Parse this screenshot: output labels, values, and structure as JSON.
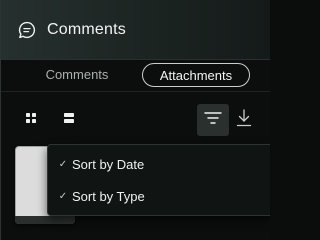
{
  "header": {
    "title": "Comments",
    "icon": "chat-bubble-icon"
  },
  "tabs": [
    {
      "label": "Comments",
      "active": false
    },
    {
      "label": "Attachments",
      "active": true
    }
  ],
  "toolbar": {
    "grid_view_icon": "grid-icon",
    "list_view_icon": "list-icon",
    "filter_icon": "sort-filter-icon",
    "download_icon": "download-icon"
  },
  "sort_menu": {
    "items": [
      {
        "label": "Sort by Date",
        "checked": true
      },
      {
        "label": "Sort by Type",
        "checked": true
      }
    ]
  },
  "colors": {
    "background": "#0b0e0d",
    "header_gradient_start": "#26302e",
    "text_primary": "#f2f4f3",
    "text_muted": "#a9b0ad",
    "active_tab_border": "#c9cfcc"
  }
}
